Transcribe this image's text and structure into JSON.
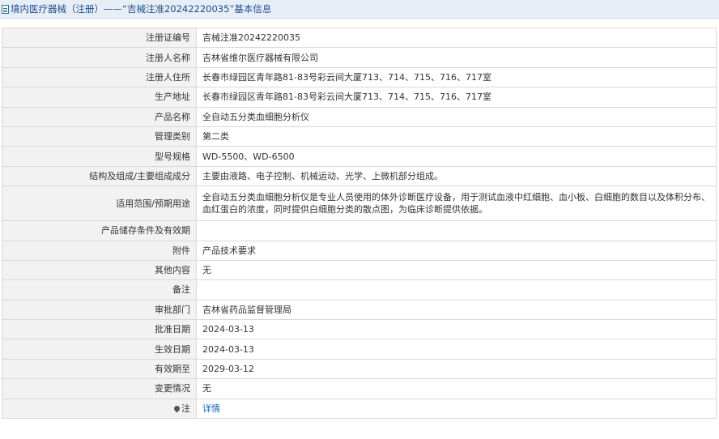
{
  "header": {
    "title": "境内医疗器械（注册）——“吉械注准20242220035”基本信息"
  },
  "rows": [
    {
      "label": "注册证编号",
      "value": "吉械注准20242220035"
    },
    {
      "label": "注册人名称",
      "value": "吉林省维尔医疗器械有限公司"
    },
    {
      "label": "注册人住所",
      "value": "长春市绿园区青年路81-83号彩云间大厦713、714、715、716、717室"
    },
    {
      "label": "生产地址",
      "value": "长春市绿园区青年路81-83号彩云间大厦713、714、715、716、717室"
    },
    {
      "label": "产品名称",
      "value": "全自动五分类血细胞分析仪"
    },
    {
      "label": "管理类别",
      "value": "第二类"
    },
    {
      "label": "型号规格",
      "value": "WD-5500、WD-6500"
    },
    {
      "label": "结构及组成/主要组成成分",
      "value": "主要由液路、电子控制、机械运动、光学、上微机部分组成。"
    },
    {
      "label": "适用范围/预期用途",
      "value": "全自动五分类血细胞分析仪是专业人员使用的体外诊断医疗设备，用于测试血液中红细胞、血小板、白细胞的数目以及体积分布、血红蛋白的浓度，同时提供白细胞分类的散点图，为临床诊断提供依据。"
    },
    {
      "label": "产品储存条件及有效期",
      "value": ""
    },
    {
      "label": "附件",
      "value": "产品技术要求"
    },
    {
      "label": "其他内容",
      "value": "无"
    },
    {
      "label": "备注",
      "value": ""
    },
    {
      "label": "审批部门",
      "value": "吉林省药品监督管理局"
    },
    {
      "label": "批准日期",
      "value": "2024-03-13"
    },
    {
      "label": "生效日期",
      "value": "2024-03-13"
    },
    {
      "label": "有效期至",
      "value": "2029-03-12"
    },
    {
      "label": "变更情况",
      "value": "无"
    }
  ],
  "note_row": {
    "label": "注",
    "icon": "pin-icon",
    "link_text": "详情"
  },
  "colors": {
    "title": "#1f4e8c",
    "label_bg": "#f2f2f2",
    "border": "#d9d9d9",
    "link": "#1a62b8"
  }
}
